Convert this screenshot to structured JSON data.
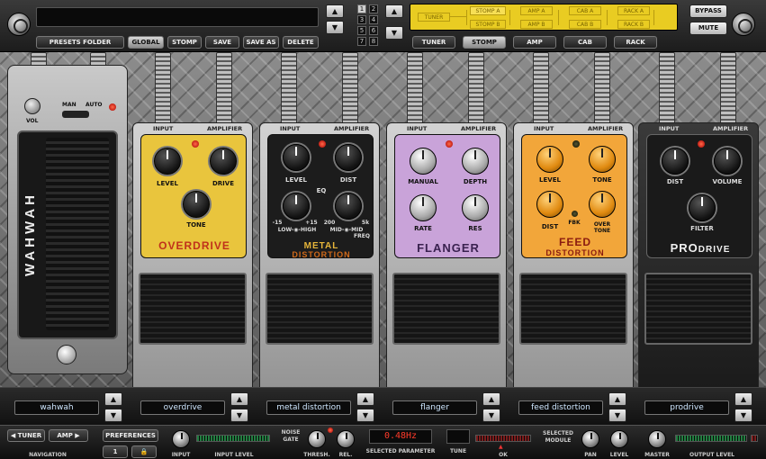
{
  "top": {
    "presets_folder": "PRESETS FOLDER",
    "global": "GLOBAL",
    "stomp": "STOMP",
    "save": "SAVE",
    "save_as": "SAVE AS",
    "delete": "DELETE",
    "bypass": "BYPASS",
    "mute": "MUTE",
    "preset_numbers": [
      "1",
      "2",
      "3",
      "4",
      "5",
      "6",
      "7",
      "8"
    ],
    "selected_preset": "1",
    "module_tabs": [
      "TUNER",
      "STOMP",
      "AMP",
      "CAB",
      "RACK"
    ],
    "active_tab": "STOMP",
    "chain": {
      "tuner": "TUNER",
      "stomp_a": "STOMP A",
      "stomp_b": "STOMP B",
      "amp_a": "AMP A",
      "amp_b": "AMP B",
      "cab_a": "CAB A",
      "cab_b": "CAB B",
      "rack_a": "RACK A",
      "rack_b": "RACK B"
    }
  },
  "wah": {
    "title": "WAHWAH",
    "vol": "VOL",
    "man": "MAN",
    "auto": "AUTO"
  },
  "io": {
    "input": "INPUT",
    "amplifier": "AMPLIFIER"
  },
  "pedals": {
    "overdrive": {
      "title": "OVERDRIVE",
      "level": "LEVEL",
      "drive": "DRIVE",
      "tone": "TONE"
    },
    "metal": {
      "title1": "METAL",
      "title2": "DISTORTION",
      "level": "LEVEL",
      "dist": "DIST",
      "eq": "EQ",
      "low_high": "LOW-◉-HIGH",
      "mid_mid": "MID-◉-MID",
      "freq": "FREQ",
      "m15": "-15",
      "p15": "+15",
      "f200": "200",
      "f5k": "5k"
    },
    "flanger": {
      "title": "FLANGER",
      "manual": "MANUAL",
      "depth": "DEPTH",
      "rate": "RATE",
      "res": "RES"
    },
    "feed": {
      "title1": "FEED",
      "title2": "DISTORTION",
      "level": "LEVEL",
      "tone": "TONE",
      "dist": "DIST",
      "fbk": "FBK",
      "over": "OVER",
      "over_tone": "TONE"
    },
    "pro": {
      "title_a": "PRO",
      "title_b": "DRIVE",
      "dist": "DIST",
      "volume": "VOLUME",
      "filter": "FILTER"
    }
  },
  "slots": [
    "wahwah",
    "overdrive",
    "metal distortion",
    "flanger",
    "feed distortion",
    "prodrive"
  ],
  "bottom": {
    "navigation": "NAVIGATION",
    "tuner": "TUNER",
    "amp": "AMP",
    "preferences": "PREFERENCES",
    "num_one": "1",
    "input": "INPUT",
    "input_level": "INPUT LEVEL",
    "noise": "NOISE",
    "gate": "GATE",
    "thresh": "THRESH.",
    "rel": "REL.",
    "selected_parameter": "SELECTED PARAMETER",
    "param_value": "0.48Hz",
    "tune": "TUNE",
    "ok": "OK",
    "selected": "SELECTED",
    "module": "MODULE",
    "pan": "PAN",
    "level": "LEVEL",
    "master": "MASTER",
    "output_level": "OUTPUT LEVEL"
  },
  "colors": {
    "overdrive": "#e9c53d",
    "metal": "#1c1c1c",
    "flanger": "#c9a3d9",
    "feed": "#f2a63a",
    "pro": "#1a1a1a",
    "chain": "#e9cc22",
    "lcd": "#ff3b2a"
  }
}
